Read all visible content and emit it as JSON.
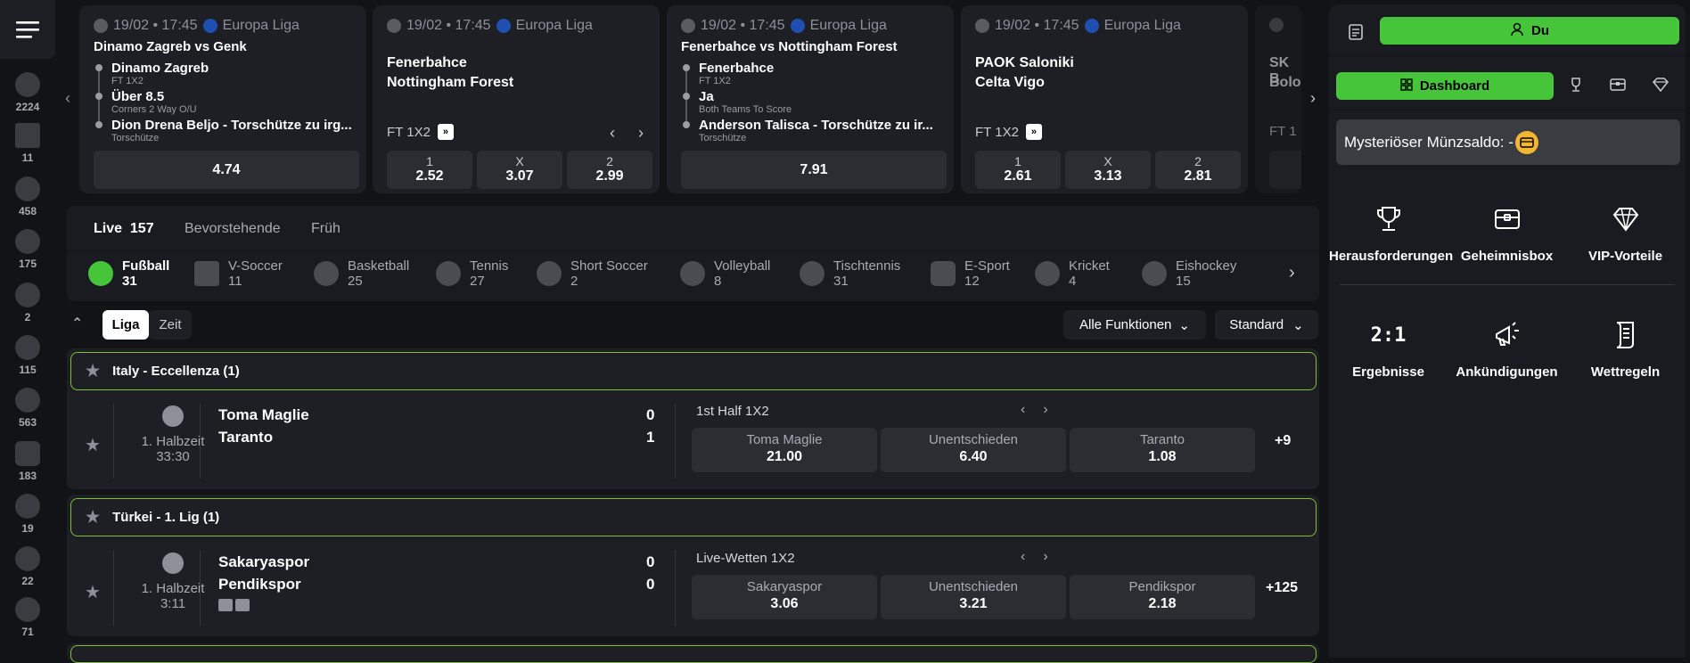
{
  "rail": {
    "items": [
      {
        "icon": "football-icon",
        "count": "2224"
      },
      {
        "icon": "v-soccer-icon",
        "count": "11"
      },
      {
        "icon": "basketball-icon",
        "count": "458"
      },
      {
        "icon": "tennis-icon",
        "count": "175"
      },
      {
        "icon": "short-soccer-icon",
        "count": "2"
      },
      {
        "icon": "volleyball-icon",
        "count": "115"
      },
      {
        "icon": "table-tennis-icon",
        "count": "563"
      },
      {
        "icon": "esport-icon",
        "count": "183"
      },
      {
        "icon": "american-football-icon",
        "count": "19"
      },
      {
        "icon": "baseball-icon",
        "count": "22"
      },
      {
        "icon": "boxing-icon",
        "count": "71"
      }
    ]
  },
  "featured": [
    {
      "date": "19/02 • 17:45",
      "league": "Europa Liga",
      "title": "Dinamo Zagreb vs Genk",
      "legs": [
        {
          "a": "Dinamo Zagreb",
          "b": "FT 1X2"
        },
        {
          "a": "Über 8.5",
          "b": "Corners 2 Way O/U"
        },
        {
          "a": "Dion Drena Beljo - Torschütze zu irg...",
          "b": "Torschütze"
        }
      ],
      "odds": "4.74"
    },
    {
      "date": "19/02 • 17:45",
      "league": "Europa Liga",
      "team1": "Fenerbahce",
      "team2": "Nottingham Forest",
      "market": "FT 1X2",
      "odds": [
        {
          "l": "1",
          "v": "2.52"
        },
        {
          "l": "X",
          "v": "3.07"
        },
        {
          "l": "2",
          "v": "2.99"
        }
      ]
    },
    {
      "date": "19/02 • 17:45",
      "league": "Europa Liga",
      "title": "Fenerbahce vs Nottingham Forest",
      "legs": [
        {
          "a": "Fenerbahce",
          "b": "FT 1X2"
        },
        {
          "a": "Ja",
          "b": "Both Teams To Score"
        },
        {
          "a": "Anderson Talisca - Torschütze zu ir...",
          "b": "Torschütze"
        }
      ],
      "odds": "7.91"
    },
    {
      "date": "19/02 • 17:45",
      "league": "Europa Liga",
      "team1": "PAOK Saloniki",
      "team2": "Celta Vigo",
      "market": "FT 1X2",
      "odds": [
        {
          "l": "1",
          "v": "2.61"
        },
        {
          "l": "X",
          "v": "3.13"
        },
        {
          "l": "2",
          "v": "2.81"
        }
      ]
    },
    {
      "team1": "SK B",
      "team2": "Bolo",
      "market": "FT 1"
    }
  ],
  "tabs": {
    "live_label": "Live",
    "live_count": "157",
    "upcoming": "Bevorstehende",
    "early": "Früh"
  },
  "sports": [
    {
      "name": "Fußball",
      "count": "31"
    },
    {
      "name": "V-Soccer",
      "count": "11"
    },
    {
      "name": "Basketball",
      "count": "25"
    },
    {
      "name": "Tennis",
      "count": "27"
    },
    {
      "name": "Short Soccer",
      "count": "2"
    },
    {
      "name": "Volleyball",
      "count": "8"
    },
    {
      "name": "Tischtennis",
      "count": "31"
    },
    {
      "name": "E-Sport",
      "count": "12"
    },
    {
      "name": "Kricket",
      "count": "4"
    },
    {
      "name": "Eishockey",
      "count": "15"
    }
  ],
  "filters": {
    "liga": "Liga",
    "zeit": "Zeit",
    "functions": "Alle Funktionen",
    "standard": "Standard"
  },
  "leagues": [
    {
      "name": "Italy - Eccellenza (1)",
      "match": {
        "period": "1. Halbzeit",
        "clock": "33:30",
        "team1": "Toma Maglie",
        "team2": "Taranto",
        "score1": "0",
        "score2": "1",
        "market": "1st Half 1X2",
        "odds": [
          {
            "l": "Toma Maglie",
            "v": "21.00"
          },
          {
            "l": "Unentschieden",
            "v": "6.40"
          },
          {
            "l": "Taranto",
            "v": "1.08"
          }
        ],
        "more": "+9"
      }
    },
    {
      "name": "Türkei - 1. Lig (1)",
      "match": {
        "period": "1. Halbzeit",
        "clock": "3:11",
        "team1": "Sakaryaspor",
        "team2": "Pendikspor",
        "score1": "0",
        "score2": "0",
        "market": "Live-Wetten 1X2",
        "odds": [
          {
            "l": "Sakaryaspor",
            "v": "3.06"
          },
          {
            "l": "Unentschieden",
            "v": "3.21"
          },
          {
            "l": "Pendikspor",
            "v": "2.18"
          }
        ],
        "more": "+125"
      }
    }
  ],
  "right": {
    "user_button": "Du",
    "dashboard_tab": "Dashboard",
    "coin_label": "Mysteriöser Münzsaldo: -",
    "tiles": [
      {
        "icon": "trophy-icon",
        "label": "Herausforderungen"
      },
      {
        "icon": "secret-box-icon",
        "label": "Geheimnisbox"
      },
      {
        "icon": "diamond-icon",
        "label": "VIP-Vorteile"
      },
      {
        "icon": "results-icon",
        "label": "Ergebnisse"
      },
      {
        "icon": "megaphone-icon",
        "label": "Ankündigungen"
      },
      {
        "icon": "rules-icon",
        "label": "Wettregeln"
      }
    ],
    "results_glyph": "2:1"
  },
  "colors": {
    "accent": "#46c53a",
    "outline": "#7bbf3a",
    "panel": "#1e1f24",
    "bg": "#121316"
  }
}
